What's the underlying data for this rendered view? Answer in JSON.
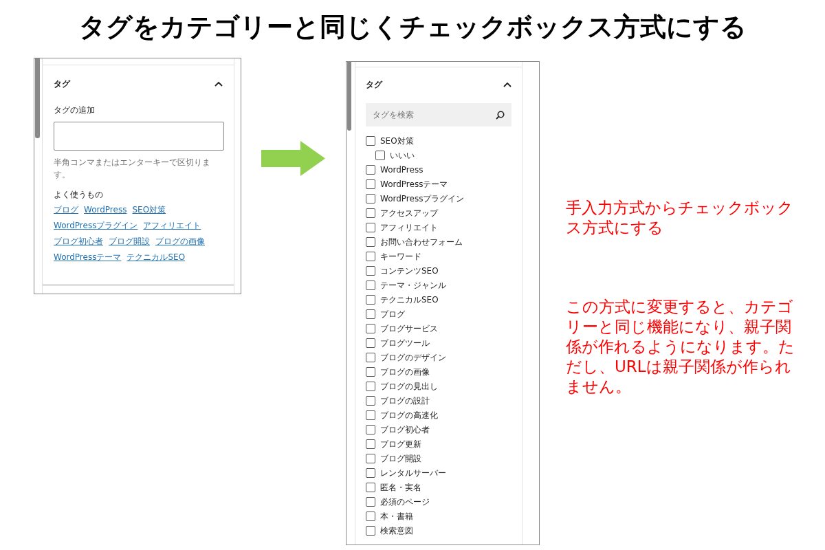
{
  "title": "タグをカテゴリーと同じくチェックボックス方式にする",
  "before_panel": {
    "heading": "タグ",
    "expanded": true,
    "add_label": "タグの追加",
    "help": "半角コンマまたはエンターキーで区切ります。",
    "frequent_label": "よく使うもの",
    "tag_links": [
      [
        "ブログ",
        "WordPress",
        "SEO対策"
      ],
      [
        "WordPressプラグイン",
        "アフィリエイト"
      ],
      [
        "ブログ初心者",
        "ブログ開設",
        "ブログの画像"
      ],
      [
        "WordPressテーマ",
        "テクニカルSEO"
      ]
    ]
  },
  "after_panel": {
    "heading": "タグ",
    "expanded": true,
    "search": {
      "placeholder": "タグを検索"
    },
    "tags": [
      {
        "label": "SEO対策",
        "checked": false,
        "children": [
          {
            "label": "いいい",
            "checked": false
          }
        ]
      },
      {
        "label": "WordPress",
        "checked": false
      },
      {
        "label": "WordPressテーマ",
        "checked": false
      },
      {
        "label": "WordPressプラグイン",
        "checked": false
      },
      {
        "label": "アクセスアップ",
        "checked": false
      },
      {
        "label": "アフィリエイト",
        "checked": false
      },
      {
        "label": "お問い合わせフォーム",
        "checked": false
      },
      {
        "label": "キーワード",
        "checked": false
      },
      {
        "label": "コンテンツSEO",
        "checked": false
      },
      {
        "label": "テーマ・ジャンル",
        "checked": false
      },
      {
        "label": "テクニカルSEO",
        "checked": false
      },
      {
        "label": "ブログ",
        "checked": false
      },
      {
        "label": "ブログサービス",
        "checked": false
      },
      {
        "label": "ブログツール",
        "checked": false
      },
      {
        "label": "ブログのデザイン",
        "checked": false
      },
      {
        "label": "ブログの画像",
        "checked": false
      },
      {
        "label": "ブログの見出し",
        "checked": false
      },
      {
        "label": "ブログの設計",
        "checked": false
      },
      {
        "label": "ブログの高速化",
        "checked": false
      },
      {
        "label": "ブログ初心者",
        "checked": false
      },
      {
        "label": "ブログ更新",
        "checked": false
      },
      {
        "label": "ブログ開設",
        "checked": false
      },
      {
        "label": "レンタルサーバー",
        "checked": false
      },
      {
        "label": "匿名・実名",
        "checked": false
      },
      {
        "label": "必須のページ",
        "checked": false
      },
      {
        "label": "本・書籍",
        "checked": false
      },
      {
        "label": "検索意図",
        "checked": false
      }
    ]
  },
  "notes": [
    "手入力方式からチェックボックス方式にする",
    "この方式に変更すると、カテゴリーと同じ機能になり、親子関係が作れるようになります。ただし、URLは親子関係が作られません。"
  ]
}
